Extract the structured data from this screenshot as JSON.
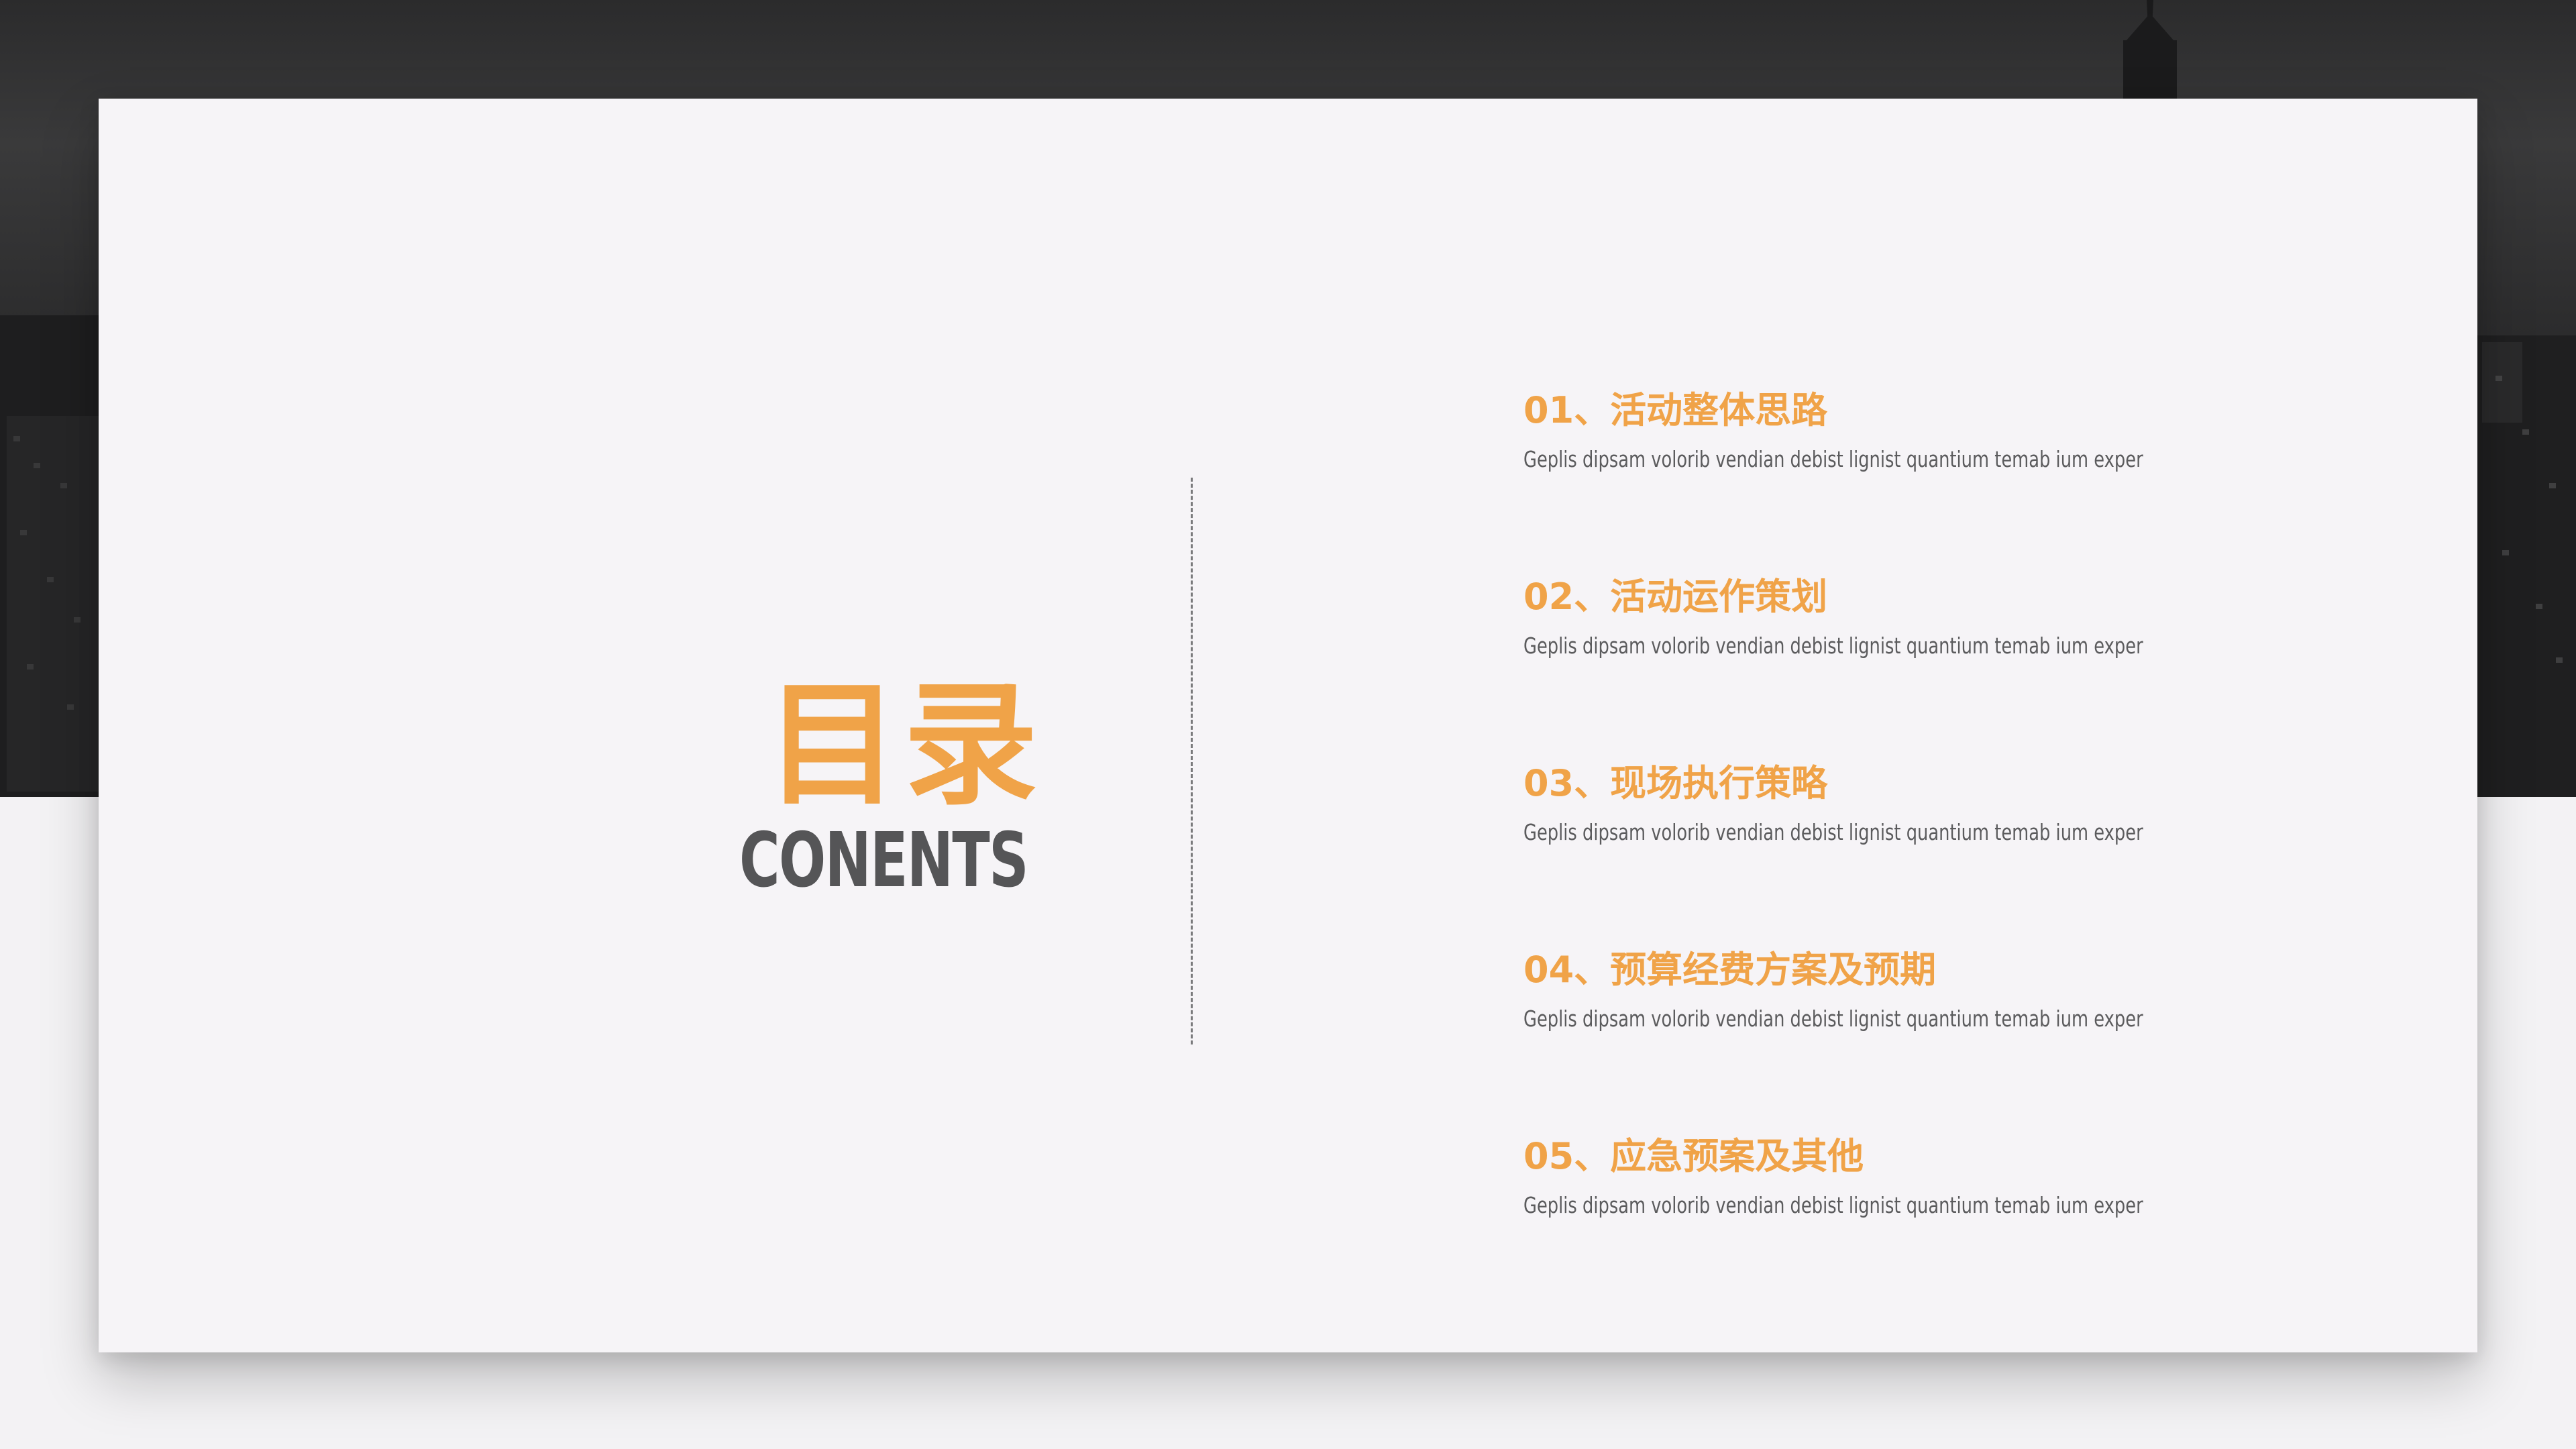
{
  "slide": {
    "title_cn": "目录",
    "title_en": "CONENTS",
    "accent_color": "#f0a348",
    "text_color": "#555557"
  },
  "toc": [
    {
      "title": "01、活动整体思路",
      "description": "Geplis dipsam volorib vendian debist lignist quantium temab ium exper"
    },
    {
      "title": "02、活动运作策划",
      "description": "Geplis dipsam volorib vendian debist lignist quantium temab ium exper"
    },
    {
      "title": "03、现场执行策略",
      "description": "Geplis dipsam volorib vendian debist lignist quantium temab ium exper"
    },
    {
      "title": "04、预算经费方案及预期",
      "description": "Geplis dipsam volorib vendian debist lignist quantium temab ium exper"
    },
    {
      "title": "05、应急预案及其他",
      "description": "Geplis dipsam volorib vendian debist lignist quantium temab ium exper"
    }
  ]
}
